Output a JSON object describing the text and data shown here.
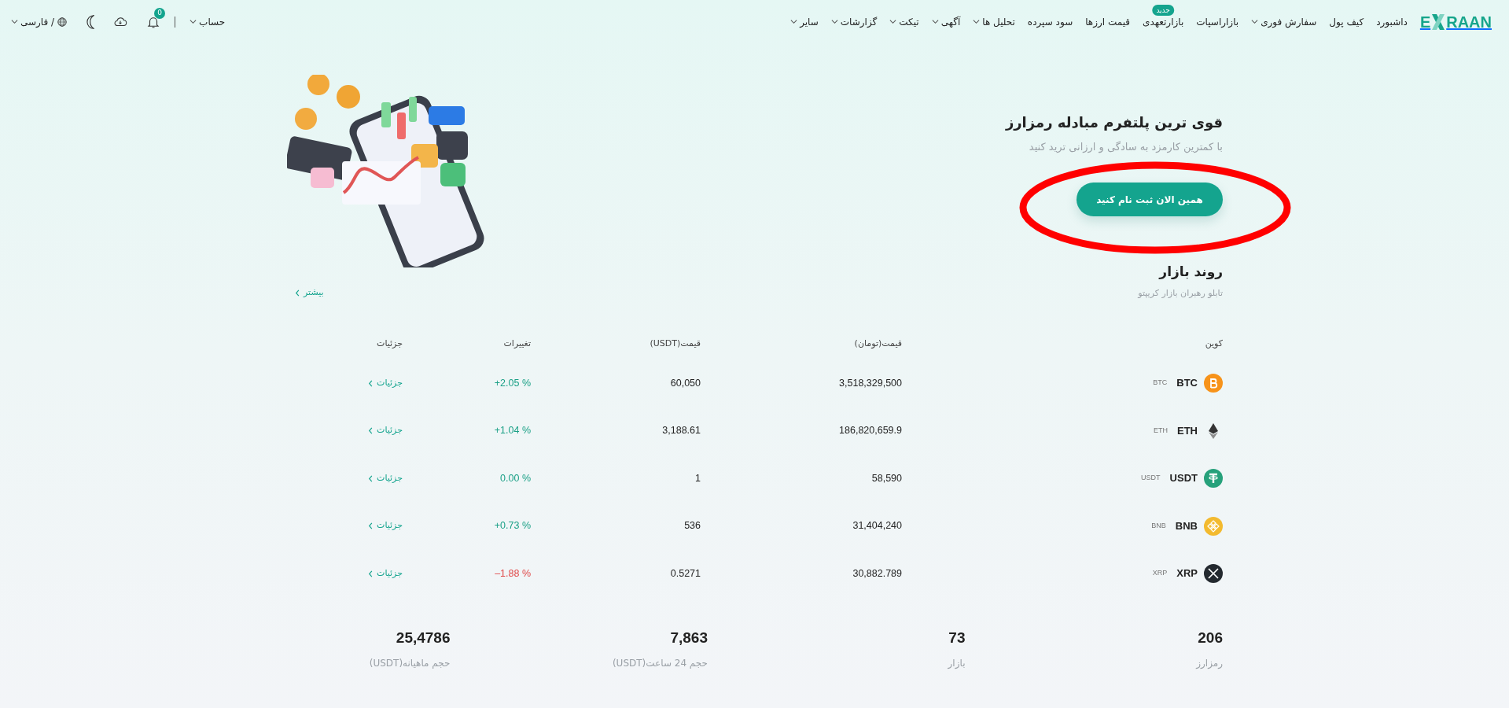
{
  "nav": {
    "logo": {
      "left": "E",
      "right": "RAAN"
    },
    "items": [
      {
        "label": "داشبورد",
        "dropdown": false
      },
      {
        "label": "کیف پول",
        "dropdown": false
      },
      {
        "label": "سفارش فوری",
        "dropdown": true
      },
      {
        "label": "بازاراسپات",
        "dropdown": false
      },
      {
        "label": "بازارتعهدی",
        "dropdown": false,
        "badge": "جدید"
      },
      {
        "label": "قیمت ارزها",
        "dropdown": false
      },
      {
        "label": "سود سپرده",
        "dropdown": false
      },
      {
        "label": "تحلیل ها",
        "dropdown": true
      },
      {
        "label": "آگهی",
        "dropdown": true
      },
      {
        "label": "تیکت",
        "dropdown": true
      },
      {
        "label": "گزارشات",
        "dropdown": true
      },
      {
        "label": "سایر",
        "dropdown": true
      }
    ],
    "account": {
      "label": "حساب"
    },
    "notifications": {
      "count": "0"
    },
    "language": {
      "label": "/ فارسی"
    }
  },
  "hero": {
    "title": "قوی ترین پلتفرم مبادله رمزارز",
    "subtitle": "با کمترین کارمزد به سادگی و ارزانی ترید کنید",
    "button": "همین الان ثبت نام کنید"
  },
  "annotations": [
    {
      "kind": "ellipse"
    }
  ],
  "market": {
    "title": "روند بازار",
    "subtitle": "تابلو رهبران بازار کریپتو",
    "more_link": "بیشتر",
    "columns": [
      "کوین",
      "قیمت(تومان)",
      "قیمت(USDT)",
      "تغییرات",
      "جزئیات"
    ],
    "rows": [
      {
        "kind": "btc",
        "symbol": "BTC",
        "code": "BTC",
        "price_toman": "3,518,329,500",
        "price_usdt": "60,050",
        "change": "+2.05 %",
        "positive": true,
        "details": "جزئیات"
      },
      {
        "kind": "eth",
        "symbol": "ETH",
        "code": "ETH",
        "price_toman": "186,820,659.9",
        "price_usdt": "3,188.61",
        "change": "+1.04 %",
        "positive": true,
        "details": "جزئیات"
      },
      {
        "kind": "usdt",
        "symbol": "USDT",
        "code": "USDT",
        "price_toman": "58,590",
        "price_usdt": "1",
        "change": "0.00 %",
        "positive": true,
        "details": "جزئیات"
      },
      {
        "kind": "bnb",
        "symbol": "BNB",
        "code": "BNB",
        "price_toman": "31,404,240",
        "price_usdt": "536",
        "change": "+0.73 %",
        "positive": true,
        "details": "جزئیات"
      },
      {
        "kind": "xrp",
        "symbol": "XRP",
        "code": "XRP",
        "price_toman": "30,882.789",
        "price_usdt": "0.5271",
        "change": "–1.88 %",
        "positive": false,
        "details": "جزئیات"
      }
    ]
  },
  "stats": [
    {
      "value": "206",
      "label": "رمزارز"
    },
    {
      "value": "73",
      "label": "بازار"
    },
    {
      "value": "7,863",
      "label": "حجم 24 ساعت(USDT)"
    },
    {
      "value": "25,4786",
      "label": "حجم ماهیانه(USDT)"
    }
  ]
}
